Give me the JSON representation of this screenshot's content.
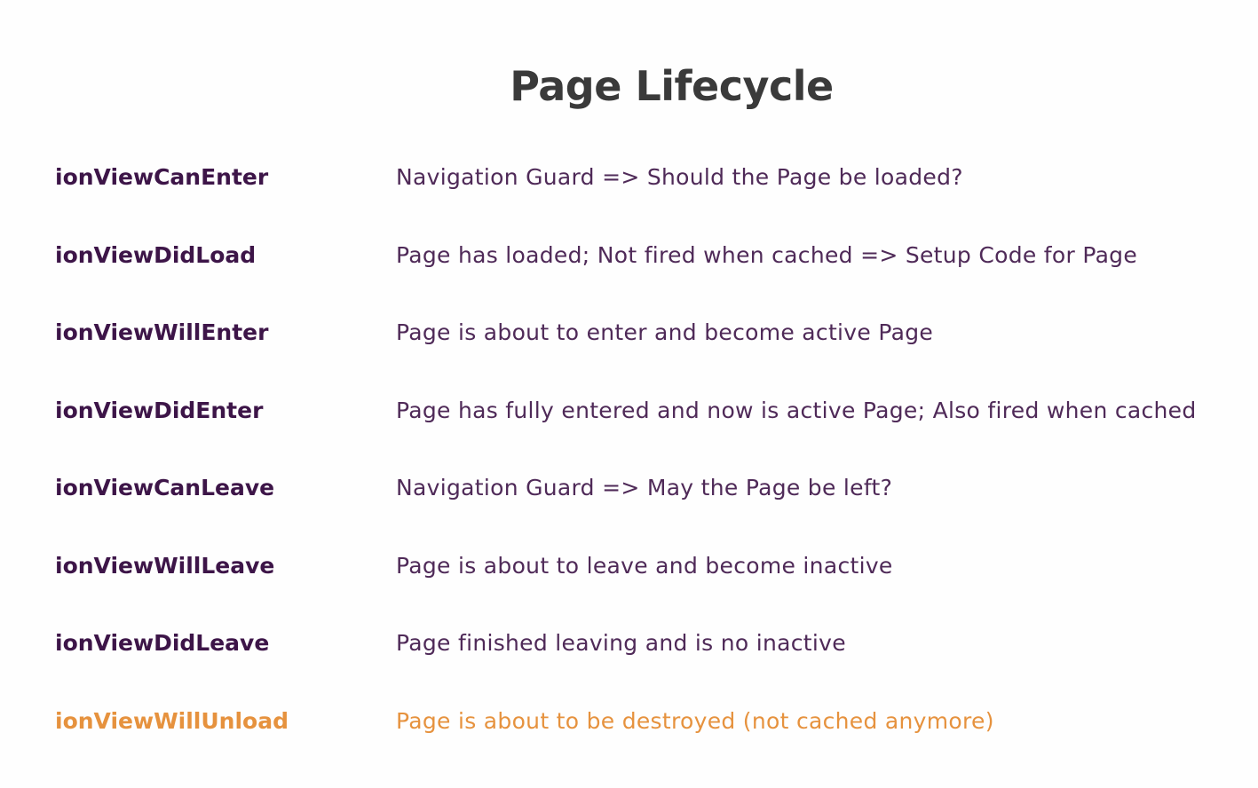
{
  "title": "Page Lifecycle",
  "colors": {
    "hook": "#3d1548",
    "description": "#4f2a58",
    "highlight": "#e6923e",
    "title": "#3a3a3a"
  },
  "hooks": [
    {
      "name": "ionViewCanEnter",
      "description": "Navigation Guard => Should the Page be loaded?",
      "highlighted": false
    },
    {
      "name": "ionViewDidLoad",
      "description": "Page has loaded; Not fired when cached => Setup Code for Page",
      "highlighted": false
    },
    {
      "name": "ionViewWillEnter",
      "description": "Page is about to enter and become active Page",
      "highlighted": false
    },
    {
      "name": "ionViewDidEnter",
      "description": "Page has fully entered and now is active Page; Also fired when cached",
      "highlighted": false
    },
    {
      "name": "ionViewCanLeave",
      "description": "Navigation Guard => May the Page be left?",
      "highlighted": false
    },
    {
      "name": "ionViewWillLeave",
      "description": "Page is about to leave and become inactive",
      "highlighted": false
    },
    {
      "name": "ionViewDidLeave",
      "description": "Page finished leaving and is no inactive",
      "highlighted": false
    },
    {
      "name": "ionViewWillUnload",
      "description": "Page is about to be destroyed (not cached anymore)",
      "highlighted": true
    }
  ]
}
